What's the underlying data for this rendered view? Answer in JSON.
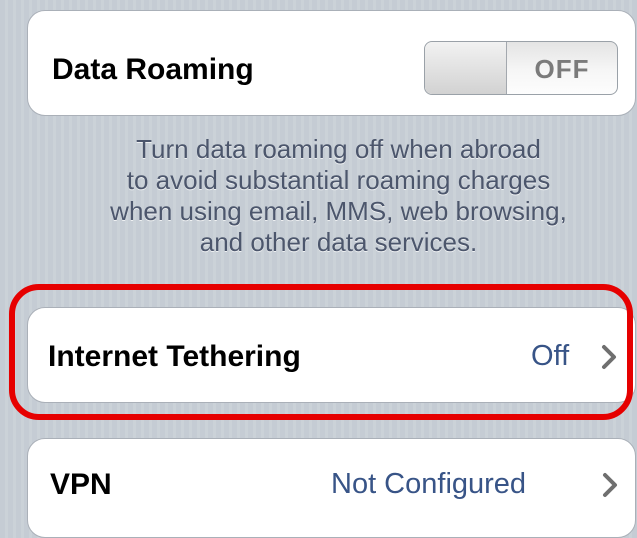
{
  "data_roaming": {
    "label": "Data Roaming",
    "toggle_state": "OFF"
  },
  "footer_lines": [
    "Turn data roaming off when abroad",
    "to avoid substantial roaming charges",
    "when using email, MMS, web browsing,",
    "and other data services."
  ],
  "internet_tethering": {
    "label": "Internet Tethering",
    "value": "Off"
  },
  "vpn": {
    "label": "VPN",
    "value": "Not Configured"
  },
  "colors": {
    "background": "#c5ccd4",
    "value_text": "#385487",
    "highlight": "#e60000"
  },
  "icons": {
    "disclosure": "chevron-right-icon"
  }
}
